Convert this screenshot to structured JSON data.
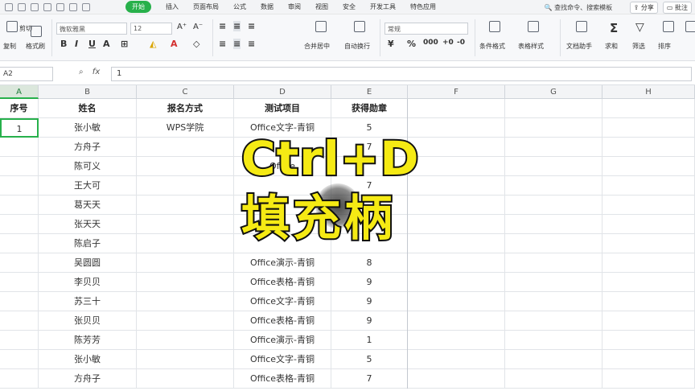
{
  "menubar": {
    "tabs": [
      "开始",
      "插入",
      "页面布局",
      "公式",
      "数据",
      "审阅",
      "视图",
      "安全",
      "开发工具",
      "特色应用"
    ],
    "active_tab": "开始",
    "search_text": "查找命令、搜索模板",
    "share_label": "分享",
    "comment_label": "批注"
  },
  "ribbon": {
    "cut_label": "剪切",
    "copy_label": "复制",
    "format_painter_label": "格式刷",
    "font_name": "微软雅黑",
    "font_size": "12",
    "merge_label": "合并居中",
    "wrap_label": "自动换行",
    "number_format": "常规",
    "cond_format_label": "条件格式",
    "table_style_label": "表格样式",
    "doc_helper_label": "文档助手",
    "sum_label": "求和",
    "filter_label": "筛选",
    "sort_label": "排序"
  },
  "formula_bar": {
    "cell_ref": "A2",
    "fx_label": "fx",
    "value": "1"
  },
  "columns": [
    "A",
    "B",
    "C",
    "D",
    "E",
    "F",
    "G",
    "H"
  ],
  "selected_column": "A",
  "table": {
    "headers": [
      "序号",
      "姓名",
      "报名方式",
      "测试项目",
      "获得勋章"
    ],
    "rows": [
      [
        "1",
        "张小敏",
        "WPS学院",
        "Office文字-青铜",
        "5"
      ],
      [
        "",
        "方舟子",
        "",
        "",
        "7"
      ],
      [
        "",
        "陈可义",
        "",
        "Office",
        ""
      ],
      [
        "",
        "王大可",
        "",
        "",
        "7"
      ],
      [
        "",
        "葛天天",
        "",
        "",
        ""
      ],
      [
        "",
        "张天天",
        "",
        "",
        ""
      ],
      [
        "",
        "陈启子",
        "",
        "",
        ""
      ],
      [
        "",
        "吴圆圆",
        "",
        "Office演示-青铜",
        "8"
      ],
      [
        "",
        "李贝贝",
        "",
        "Office表格-青铜",
        "9"
      ],
      [
        "",
        "苏三十",
        "",
        "Office文字-青铜",
        "9"
      ],
      [
        "",
        "张贝贝",
        "",
        "Office表格-青铜",
        "9"
      ],
      [
        "",
        "陈芳芳",
        "",
        "Office演示-青铜",
        "1"
      ],
      [
        "",
        "张小敏",
        "",
        "Office文字-青铜",
        "5"
      ],
      [
        "",
        "方舟子",
        "",
        "Office表格-青铜",
        "7"
      ]
    ]
  },
  "overlay": {
    "line1": "Ctrl+D",
    "line2": "填充柄"
  },
  "colors": {
    "accent": "#27b04b",
    "overlay_text": "#f5ea14",
    "overlay_stroke": "#111111"
  }
}
